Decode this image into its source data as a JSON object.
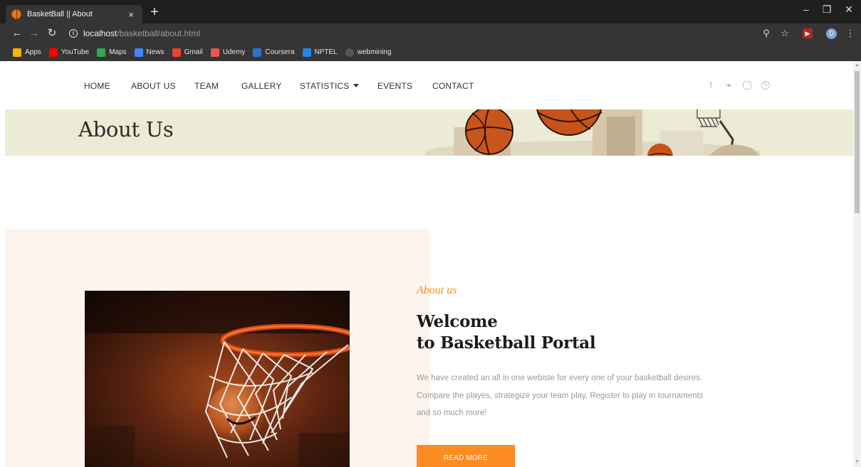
{
  "browser": {
    "tab_title": "BasketBall || About",
    "tab_close": "×",
    "new_tab": "+",
    "url_host": "localhost",
    "url_path": "/basketball/about.html",
    "avatar_letter": "D",
    "bookmarks": [
      {
        "label": "Apps",
        "color": "#f4b400"
      },
      {
        "label": "YouTube",
        "color": "#ff0000"
      },
      {
        "label": "Maps",
        "color": "#34a853"
      },
      {
        "label": "News",
        "color": "#4285f4"
      },
      {
        "label": "Gmail",
        "color": "#ea4335"
      },
      {
        "label": "Udemy",
        "color": "#ec5252"
      },
      {
        "label": "Coursera",
        "color": "#2a73cc"
      },
      {
        "label": "NPTEL",
        "color": "#1e88e5"
      },
      {
        "label": "webmining",
        "color": "#555555"
      }
    ]
  },
  "nav": {
    "home": "HOME",
    "about": "ABOUT US",
    "team": "TEAM",
    "gallery": "GALLERY",
    "statistics": "STATISTICS",
    "events": "EVENTS",
    "contact": "CONTACT"
  },
  "hero": {
    "title": "About Us"
  },
  "about": {
    "kicker": "About us",
    "headline_line1": "Welcome",
    "headline_line2": "to Basketball Portal",
    "body": "We have created an all in one webiste for every one of your basketball desires. Compare the playes, strategize your team play, Register to play in tournaments and so much more!",
    "button": "READ MORE"
  },
  "colors": {
    "accent": "#f7941d",
    "button": "#fc8c22",
    "hero_bg": "#ecebd5",
    "peach_bg": "#fef4ee"
  }
}
